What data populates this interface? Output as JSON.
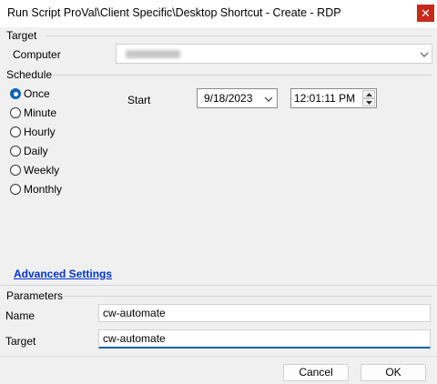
{
  "window": {
    "title": "Run Script ProVal\\Client Specific\\Desktop Shortcut - Create - RDP",
    "close_glyph": "✕"
  },
  "target": {
    "section_label": "Target",
    "computer_label": "Computer",
    "computer_value": ""
  },
  "schedule": {
    "section_label": "Schedule",
    "options": [
      {
        "label": "Once",
        "checked": true
      },
      {
        "label": "Minute",
        "checked": false
      },
      {
        "label": "Hourly",
        "checked": false
      },
      {
        "label": "Daily",
        "checked": false
      },
      {
        "label": "Weekly",
        "checked": false
      },
      {
        "label": "Monthly",
        "checked": false
      }
    ],
    "start_label": "Start",
    "date": "9/18/2023",
    "time": "12:01:11 PM"
  },
  "advanced_settings": "Advanced Settings",
  "parameters": {
    "section_label": "Parameters",
    "name_label": "Name",
    "name_value": "cw-automate",
    "target_label": "Target",
    "target_value": "cw-automate"
  },
  "buttons": {
    "cancel": "Cancel",
    "ok": "OK"
  },
  "colors": {
    "accent": "#0a64b4",
    "close": "#c42b1c",
    "link": "#0033cc"
  }
}
